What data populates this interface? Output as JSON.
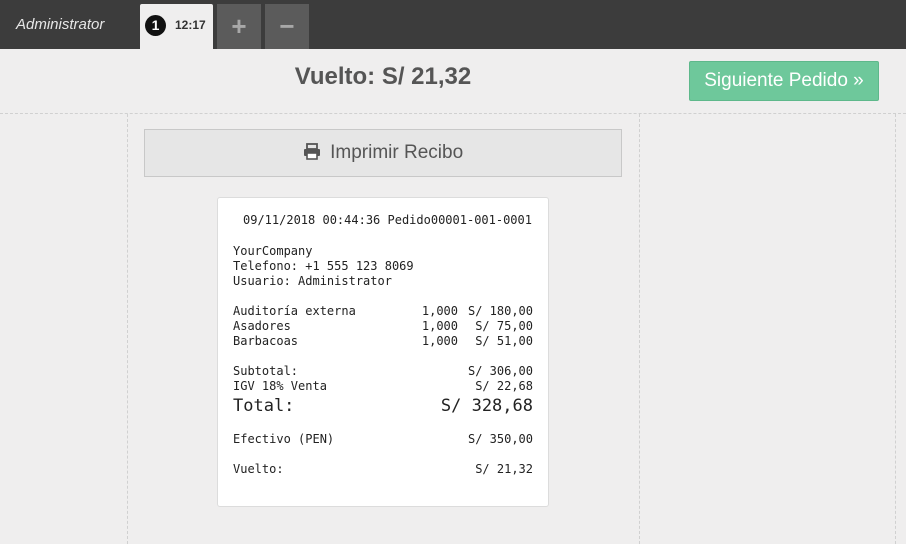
{
  "topbar": {
    "user": "Administrator",
    "order_number": "1",
    "order_time": "12:17",
    "add_label": "+",
    "remove_label": "−"
  },
  "payment": {
    "change_title": "Vuelto: S/ 21,32",
    "next_order_label": "Siguiente Pedido »",
    "print_label": "Imprimir Recibo",
    "print_icon": "printer-icon"
  },
  "receipt": {
    "header": "09/11/2018 00:44:36 Pedido00001-001-0001",
    "company": "YourCompany",
    "phone": "Telefono: +1 555 123 8069",
    "user": "Usuario: Administrator",
    "lines": [
      {
        "name": "Auditoría externa",
        "qty": "1,000",
        "price": "S/ 180,00"
      },
      {
        "name": "Asadores",
        "qty": "1,000",
        "price": "S/ 75,00"
      },
      {
        "name": "Barbacoas",
        "qty": "1,000",
        "price": "S/ 51,00"
      }
    ],
    "subtotal_label": "Subtotal:",
    "subtotal_value": "S/ 306,00",
    "tax_label": "IGV 18% Venta",
    "tax_value": "S/ 22,68",
    "total_label": "Total:",
    "total_value": "S/ 328,68",
    "cash_label": "Efectivo (PEN)",
    "cash_value": "S/ 350,00",
    "change_label": "Vuelto:",
    "change_value": "S/ 21,32"
  },
  "colors": {
    "topbar": "#3c3c3c",
    "accent_green": "#6ec89b",
    "background": "#efeeee"
  }
}
